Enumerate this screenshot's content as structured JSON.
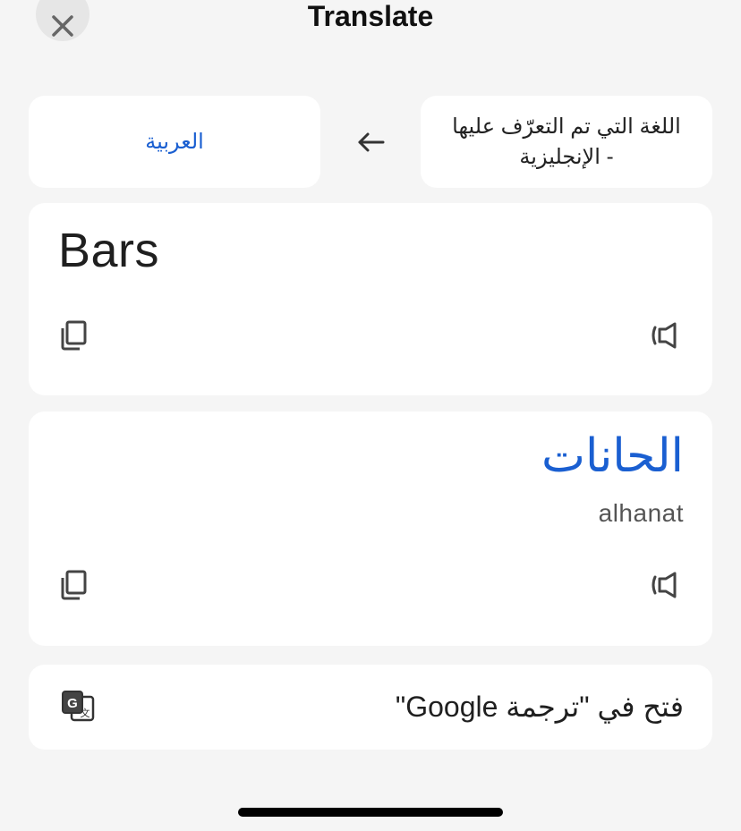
{
  "header": {
    "title": "Translate"
  },
  "languages": {
    "target_label": "العربية",
    "source_label": "اللغة التي تم التعرّف عليها - الإنجليزية"
  },
  "source": {
    "text": "Bars"
  },
  "result": {
    "text": "الحانات",
    "transliteration": "alhanat"
  },
  "open_in": {
    "label": "فتح في \"ترجمة Google\""
  },
  "colors": {
    "accent": "#1a5fd1",
    "background": "#f5f5f5",
    "card": "#ffffff"
  },
  "icons": {
    "close": "close-icon",
    "swap": "arrow-left-icon",
    "copy": "copy-icon",
    "speaker": "speaker-icon",
    "google_translate": "google-translate-icon"
  }
}
